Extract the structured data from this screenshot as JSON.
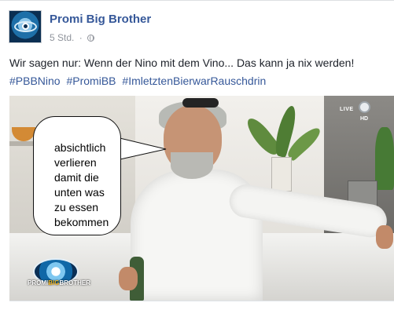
{
  "post": {
    "page_name": "Promi Big Brother",
    "time": "5 Std.",
    "separator": "·",
    "privacy_icon": "globe-icon",
    "text": "Wir sagen nur: Wenn der Nino mit dem Vino... Das kann ja nix werden!",
    "hashtags": [
      "#PBBNino",
      "#PromiBB",
      "#ImletztenBierwarRauschdrin"
    ]
  },
  "media": {
    "speech_lines": [
      "absichtlich",
      "verlieren",
      "damit die",
      "unten was",
      "zu essen",
      "bekommen"
    ],
    "channel_live": "LIVE",
    "channel_hd": "HD",
    "show_logo_text": {
      "left": "PROMI",
      "accent": "BIG",
      "right": "BROTHER"
    }
  },
  "colors": {
    "link": "#365899",
    "text": "#1d2129",
    "meta": "#90949c",
    "logo_blue": "#1068a7",
    "logo_accent": "#f6b41b"
  }
}
